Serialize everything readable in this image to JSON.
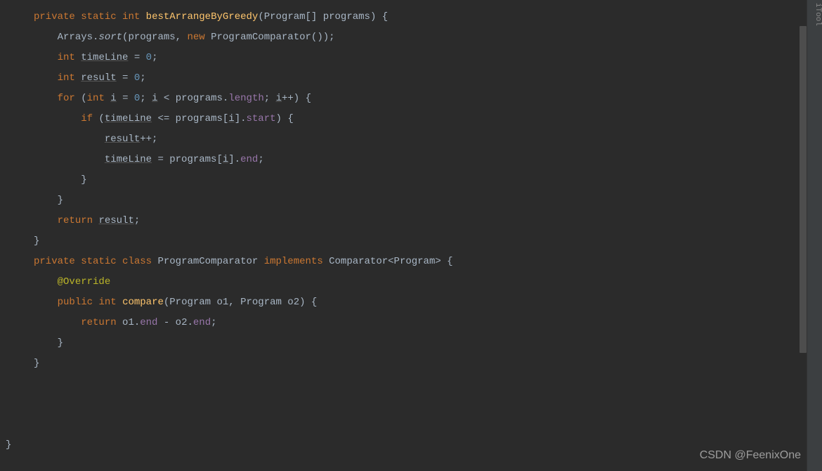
{
  "code": {
    "line1": {
      "kw1": "private",
      "kw2": "static",
      "kw3": "int",
      "method": "bestArrangeByGreedy",
      "p1": "(Program[] programs) {"
    },
    "line2": {
      "indent": "    ",
      "cls": "Arrays",
      "dot": ".",
      "call": "sort",
      "p1": "(programs, ",
      "kw": "new",
      "ctor": " ProgramComparator());"
    },
    "line3": {
      "indent": "    ",
      "kw": "int",
      "var": "timeLine",
      "eq": " = ",
      "num": "0",
      "semi": ";"
    },
    "line4": {
      "indent": "    ",
      "kw": "int",
      "var": "result",
      "eq": " = ",
      "num": "0",
      "semi": ";"
    },
    "line5": {
      "indent": "    ",
      "kw1": "for",
      "p1": " (",
      "kw2": "int",
      "var1": "i",
      "eq": " = ",
      "num": "0",
      "semi1": "; ",
      "var2": "i",
      "op": " < programs.",
      "field": "length",
      "semi2": "; ",
      "var3": "i",
      "inc": "++) {"
    },
    "line6": {
      "indent": "        ",
      "kw": "if",
      "p1": " (",
      "var": "timeLine",
      "op": " <= programs[",
      "idx": "i",
      "p2": "].",
      "field": "start",
      "p3": ") {"
    },
    "line7": {
      "indent": "            ",
      "var": "result",
      "op": "++;"
    },
    "line8": {
      "indent": "            ",
      "var": "timeLine",
      "eq": " = programs[",
      "idx": "i",
      "p1": "].",
      "field": "end",
      "semi": ";"
    },
    "line9": {
      "indent": "        ",
      "brace": "}"
    },
    "line10": {
      "indent": "    ",
      "brace": "}"
    },
    "line11": {
      "indent": "    ",
      "kw": "return",
      "sp": " ",
      "var": "result",
      "semi": ";"
    },
    "line12": {
      "brace": "}"
    },
    "line13": "",
    "line14": {
      "kw1": "private",
      "kw2": "static",
      "kw3": "class",
      "cls": "ProgramComparator",
      "kw4": "implements",
      "iface": "Comparator<Program> {"
    },
    "line15": "",
    "line16": {
      "indent": "    ",
      "anno": "@Override"
    },
    "line17": {
      "indent": "    ",
      "kw1": "public",
      "kw2": "int",
      "method": "compare",
      "p1": "(Program o1, Program o2) {"
    },
    "line18": {
      "indent": "        ",
      "kw": "return",
      "p1": " o1.",
      "f1": "end",
      "op": " - o2.",
      "f2": "end",
      "semi": ";"
    },
    "line19": {
      "indent": "    ",
      "brace": "}"
    },
    "line20": {
      "brace": "}"
    },
    "line21": "",
    "line22_brace": "}",
    "watermark": "CSDN @FeenixOne",
    "sideText": "iTool"
  }
}
